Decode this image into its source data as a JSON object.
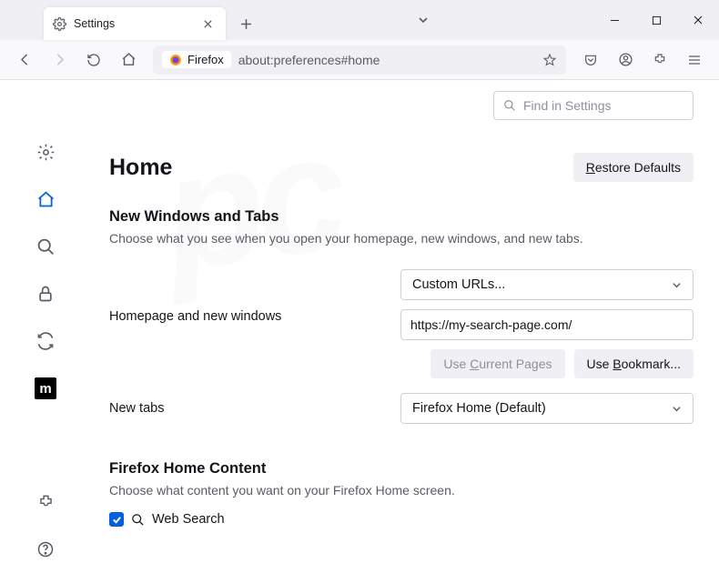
{
  "tab": {
    "title": "Settings"
  },
  "urlbar": {
    "identity": "Firefox",
    "url": "about:preferences#home"
  },
  "search": {
    "placeholder": "Find in Settings"
  },
  "page": {
    "title": "Home",
    "restore": "Restore Defaults",
    "restore_u": "R"
  },
  "section1": {
    "heading": "New Windows and Tabs",
    "desc": "Choose what you see when you open your homepage, new windows, and new tabs.",
    "homepage_label": "Homepage and new windows",
    "homepage_select": "Custom URLs...",
    "homepage_value": "https://my-search-page.com/",
    "use_current": "Use Current Pages",
    "use_bookmark": "Use Bookmark...",
    "newtabs_label": "New tabs",
    "newtabs_select": "Firefox Home (Default)"
  },
  "section2": {
    "heading": "Firefox Home Content",
    "desc": "Choose what content you want on your Firefox Home screen.",
    "websearch": "Web Search"
  }
}
